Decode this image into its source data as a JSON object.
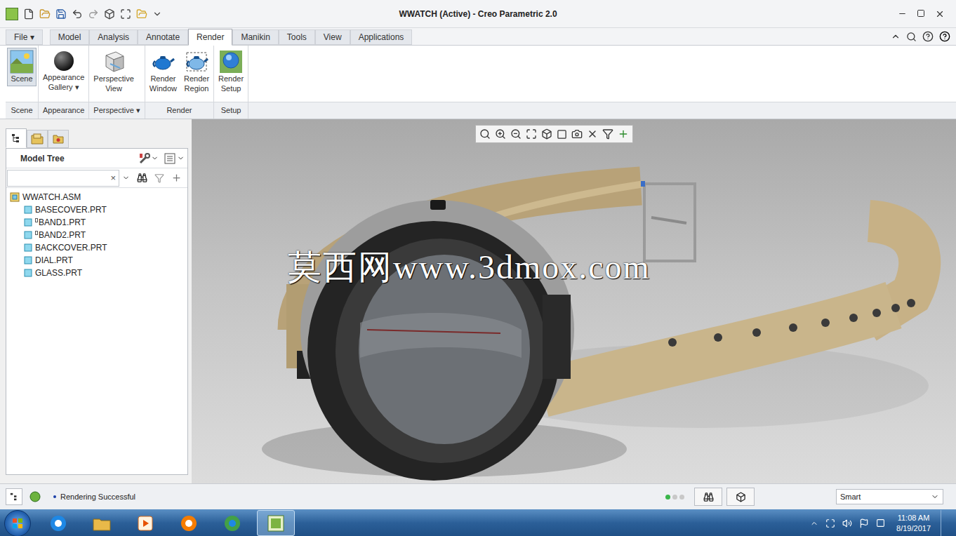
{
  "window": {
    "title": "WWATCH (Active) - Creo Parametric 2.0"
  },
  "ribbon_tabs": [
    {
      "label": "File ▾",
      "selected": false
    },
    {
      "label": "Model",
      "selected": false
    },
    {
      "label": "Analysis",
      "selected": false
    },
    {
      "label": "Annotate",
      "selected": false
    },
    {
      "label": "Render",
      "selected": true
    },
    {
      "label": "Manikin",
      "selected": false
    },
    {
      "label": "Tools",
      "selected": false
    },
    {
      "label": "View",
      "selected": false
    },
    {
      "label": "Applications",
      "selected": false
    }
  ],
  "ribbon_groups": [
    {
      "label": "Scene",
      "buttons": [
        {
          "lines": [
            "Scene"
          ],
          "selected": true
        }
      ]
    },
    {
      "label": "Appearance",
      "buttons": [
        {
          "lines": [
            "Appearance",
            "Gallery ▾"
          ],
          "selected": false
        }
      ]
    },
    {
      "label": "Perspective ▾",
      "buttons": [
        {
          "lines": [
            "Perspective",
            "View"
          ],
          "selected": false
        }
      ]
    },
    {
      "label": "Render",
      "buttons": [
        {
          "lines": [
            "Render",
            "Window"
          ],
          "selected": false
        },
        {
          "lines": [
            "Render",
            "Region"
          ],
          "selected": false
        }
      ]
    },
    {
      "label": "Setup",
      "buttons": [
        {
          "lines": [
            "Render",
            "Setup"
          ],
          "selected": false
        }
      ]
    }
  ],
  "model_tree": {
    "title": "Model Tree",
    "search": {
      "value": "",
      "clear": "×"
    },
    "items": [
      {
        "label": "WWATCH.ASM",
        "kind": "assembly",
        "marked": false
      },
      {
        "label": "BASECOVER.PRT",
        "kind": "part",
        "marked": false
      },
      {
        "label": "BAND1.PRT",
        "kind": "part",
        "marked": true
      },
      {
        "label": "BAND2.PRT",
        "kind": "part",
        "marked": true
      },
      {
        "label": "BACKCOVER.PRT",
        "kind": "part",
        "marked": false
      },
      {
        "label": "DIAL.PRT",
        "kind": "part",
        "marked": false
      },
      {
        "label": "GLASS.PRT",
        "kind": "part",
        "marked": false
      }
    ]
  },
  "viewport": {
    "watermark": "莫西网www.3dmox.com"
  },
  "status_bar": {
    "message": "Rendering Successful",
    "filter": "Smart",
    "lights": [
      {
        "color": "#3ab54a"
      },
      {
        "color": "#c8c8c8"
      },
      {
        "color": "#c8c8c8"
      }
    ]
  },
  "taskbar": {
    "apps": [
      {
        "selected": false
      },
      {
        "selected": false
      },
      {
        "selected": false
      },
      {
        "selected": false
      },
      {
        "selected": false
      },
      {
        "selected": true
      }
    ],
    "time": "11:08 AM",
    "date": "8/19/2017"
  }
}
